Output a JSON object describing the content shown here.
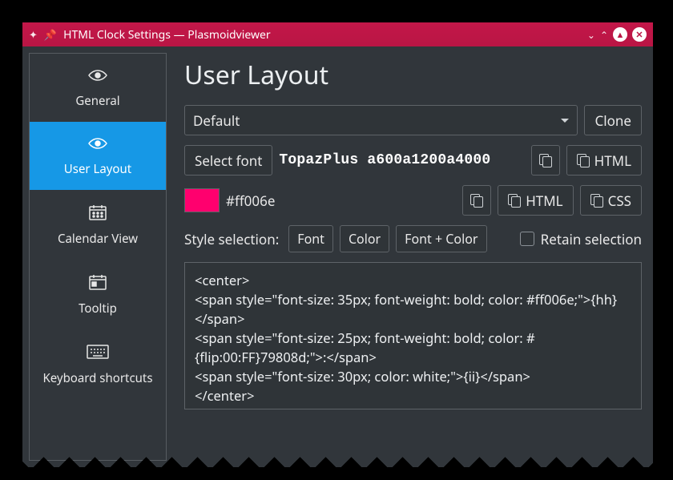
{
  "titlebar": {
    "title": "HTML Clock Settings — Plasmoidviewer"
  },
  "sidebar": {
    "items": [
      {
        "label": "General"
      },
      {
        "label": "User Layout"
      },
      {
        "label": "Calendar View"
      },
      {
        "label": "Tooltip"
      },
      {
        "label": "Keyboard shortcuts"
      }
    ]
  },
  "main": {
    "heading": "User Layout",
    "preset": {
      "selected": "Default",
      "clone_label": "Clone"
    },
    "font": {
      "select_label": "Select font",
      "current": "TopazPlus a600a1200a4000",
      "html_label": "HTML"
    },
    "color": {
      "hex": "#ff006e",
      "html_label": "HTML",
      "css_label": "CSS"
    },
    "style": {
      "label": "Style selection:",
      "font_btn": "Font",
      "color_btn": "Color",
      "both_btn": "Font + Color",
      "retain_label": "Retain selection"
    },
    "editor_text": "<center>\n<span style=\"font-size: 35px; font-weight: bold; color: #ff006e;\">{hh}</span>\n<span style=\"font-size: 25px; font-weight: bold; color: #{flip:00:FF}79808d;\">:</span>\n<span style=\"font-size: 30px; color: white;\">{ii}</span>\n</center>"
  }
}
